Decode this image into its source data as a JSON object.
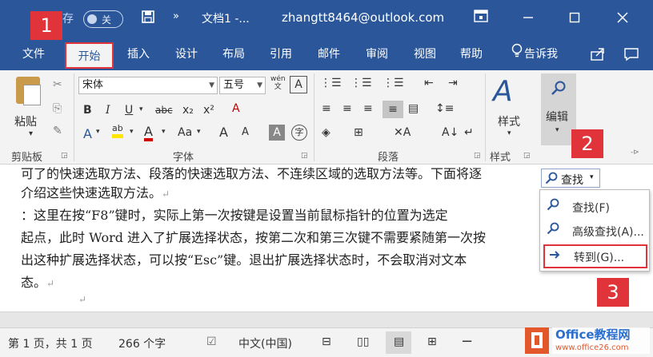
{
  "titlebar": {
    "autosave_label": "存",
    "autosave_state": "关",
    "qat_more": "»",
    "doc_title": "文档1 -...",
    "account": "zhangtt8464@outlook.com"
  },
  "tabs": [
    "文件",
    "开始",
    "插入",
    "设计",
    "布局",
    "引用",
    "邮件",
    "审阅",
    "视图",
    "帮助"
  ],
  "active_tab": "开始",
  "tell_me": "告诉我",
  "ribbon": {
    "clipboard": {
      "label": "剪贴板",
      "paste": "粘贴"
    },
    "font": {
      "label": "字体",
      "font_name": "宋体",
      "font_size": "五号",
      "pinyin_glyph": "wén",
      "bold": "B",
      "italic": "I",
      "underline": "U",
      "strike": "abc",
      "sub": "x₂",
      "sup": "x²",
      "grow": "A",
      "shrink": "A",
      "case": "Aa",
      "clear": "A",
      "font_color": "A",
      "shade": "A",
      "circle": "字"
    },
    "paragraph": {
      "label": "段落"
    },
    "styles": {
      "label": "样式",
      "button": "样式"
    },
    "editing": {
      "button": "编辑"
    }
  },
  "document": {
    "lines": [
      "可了的快速选取方法、段落的快速选取方法、不连续区域的选取方法等。下面将逐",
      "介绍这些快速选取方法。",
      "    ：这里在按“F8”键时，实际上第一次按键是设置当前鼠标指针的位置为选定",
      "起点，此时 Word 进入了扩展选择状态，按第二次和第三次键不需要紧随第一次按",
      "出这种扩展选择状态，可以按“Esc”键。退出扩展选择状态时，不会取消对文本",
      "态。"
    ],
    "para_mark": "↵"
  },
  "find_menu": {
    "button": "查找",
    "items": [
      "查找(F)",
      "高级查找(A)...",
      "转到(G)..."
    ]
  },
  "callouts": [
    "1",
    "2",
    "3"
  ],
  "status": {
    "page": "第 1 页，共 1 页",
    "words": "266 个字",
    "language": "中文(中国)",
    "zoom_minus": "−"
  },
  "watermark": {
    "brand": "Office教程网",
    "url": "www.office26.com"
  },
  "colors": {
    "word_blue": "#2b579a",
    "callout_red": "#e0343a",
    "ribbon_bg": "#f3f3f3"
  }
}
